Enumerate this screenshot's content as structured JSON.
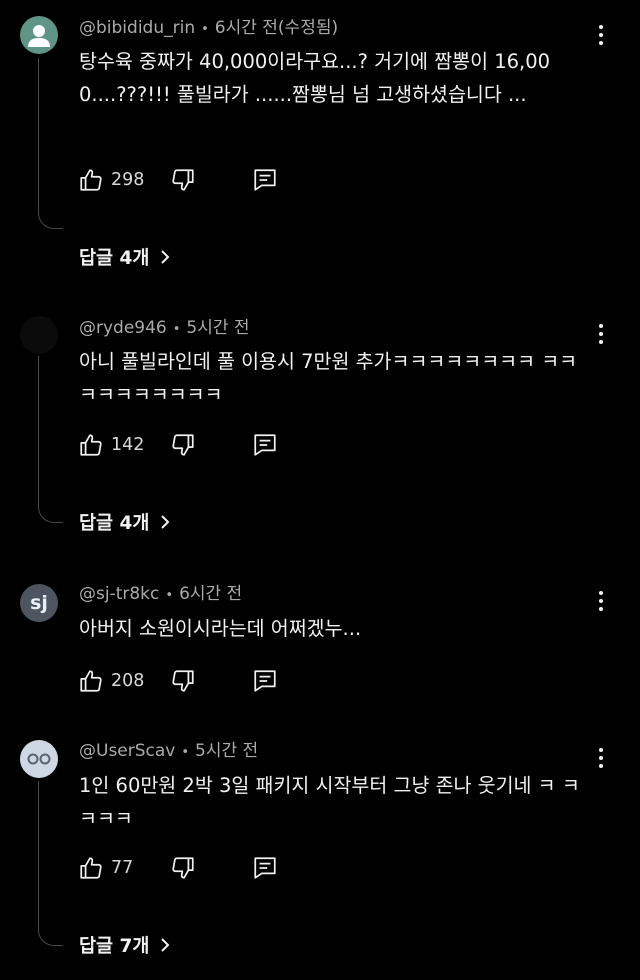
{
  "comments": [
    {
      "author": "@bibididu_rin",
      "time": "6시간 전(수정됨)",
      "text": "탕수육 중짜가 40,000이라구요...? 거기에 짬뽕이 16,000....???!!! 풀빌라가 ......짬뽕님 넘 고생하셨습니다 ...",
      "likes": "298",
      "replies_label": "답글 4개",
      "avatar": "person-icon"
    },
    {
      "author": "@ryde946",
      "time": "5시간 전",
      "text": "아니 풀빌라인데 풀 이용시 7만원 추가ㅋㅋㅋㅋㅋㅋㅋㅋ ㅋㅋㅋㅋㅋㅋㅋㅋㅋㅋ",
      "likes": "142",
      "replies_label": "답글 4개",
      "avatar": "dark-avatar"
    },
    {
      "author": "@sj-tr8kc",
      "time": "6시간 전",
      "text": "아버지 소원이시라는데 어쩌겠누...",
      "likes": "208",
      "avatar_initials": "sj"
    },
    {
      "author": "@UserScav",
      "time": "5시간 전",
      "text": "1인 60만원 2박 3일 패키지 시작부터 그냥 존나 웃기네 ㅋ ㅋㅋㅋㅋ",
      "likes": "77",
      "replies_label": "답글 7개",
      "avatar": "eyes-avatar"
    }
  ],
  "colors": {
    "background": "#000000",
    "text": "#f1f1f1",
    "meta": "#aaaaaa",
    "thread_line": "#4a4a4a"
  }
}
